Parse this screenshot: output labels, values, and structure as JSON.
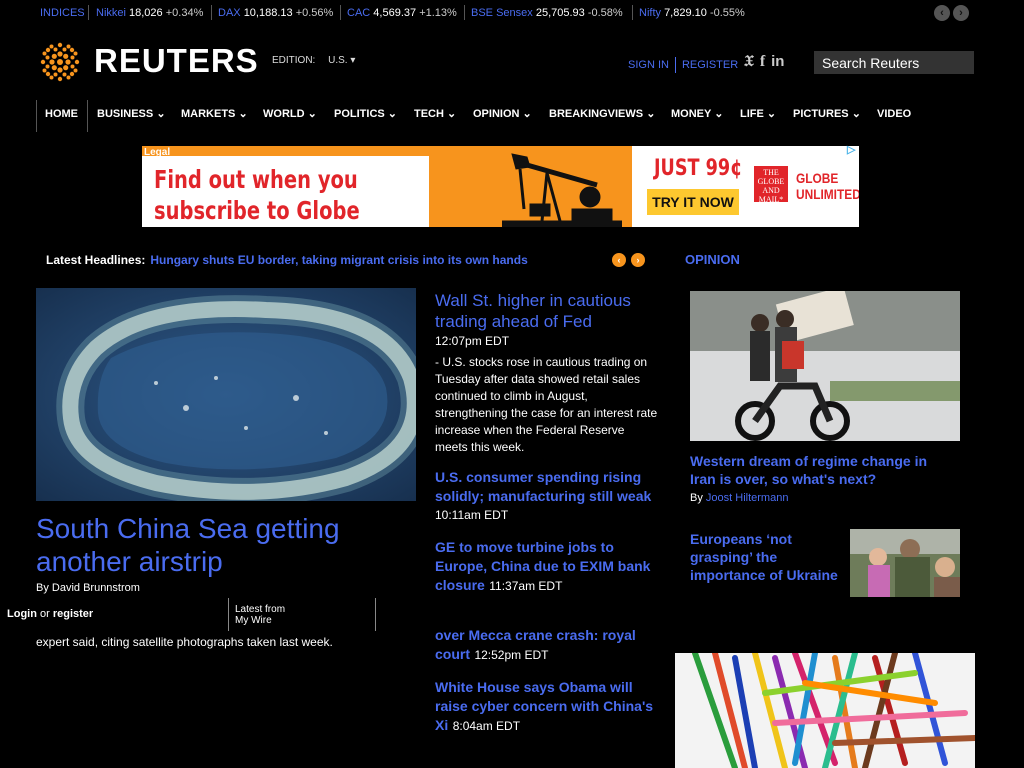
{
  "ticker": {
    "label": "INDICES",
    "items": [
      {
        "name": "Nikkei",
        "value": "18,026",
        "change": "+0.34%"
      },
      {
        "name": "DAX",
        "value": "10,188.13",
        "change": "+0.56%"
      },
      {
        "name": "CAC",
        "value": "4,569.37",
        "change": "+1.13%"
      },
      {
        "name": "BSE Sensex",
        "value": "25,705.93",
        "change": "-0.58%"
      },
      {
        "name": "Nifty",
        "value": "7,829.10",
        "change": "-0.55%"
      }
    ]
  },
  "header": {
    "logo_text": "REUTERS",
    "edition_label": "EDITION:",
    "edition_value": "U.S.",
    "sign_in": "SIGN IN",
    "register": "REGISTER",
    "social": [
      "twitter-icon",
      "facebook-icon",
      "linkedin-icon"
    ],
    "search_placeholder": "Search Reuters"
  },
  "nav": [
    {
      "label": "HOME"
    },
    {
      "label": "BUSINESS"
    },
    {
      "label": "MARKETS"
    },
    {
      "label": "WORLD"
    },
    {
      "label": "POLITICS"
    },
    {
      "label": "TECH"
    },
    {
      "label": "OPINION"
    },
    {
      "label": "BREAKINGVIEWS"
    },
    {
      "label": "MONEY"
    },
    {
      "label": "LIFE"
    },
    {
      "label": "PICTURES"
    },
    {
      "label": "VIDEO"
    }
  ],
  "ad": {
    "tag": "Legal",
    "headline": "Find out when you subscribe to Globe Unlimited.",
    "price": "JUST 99¢",
    "cta": "TRY IT NOW",
    "badge": "THE GLOBE AND MAIL*",
    "brand": "GLOBE UNLIMITED"
  },
  "latest": {
    "label": "Latest Headlines:",
    "headline": "Hungary shuts EU border, taking migrant crisis into its own hands"
  },
  "main_story": {
    "title": "South China Sea getting another airstrip",
    "byline": "By David Brunnstrom",
    "excerpt": "expert said, citing satellite photographs taken last week."
  },
  "login_bar": {
    "login": "Login",
    "or": "or",
    "register": "register",
    "wire": "Latest from My Wire"
  },
  "center_stories": [
    {
      "title": "Wall St. higher in cautious trading ahead of Fed",
      "time": "12:07pm EDT",
      "summary": "- U.S. stocks rose in cautious trading on Tuesday after data showed retail sales continued to climb in August, strengthening the case for an interest rate increase when the Federal Reserve meets this week."
    },
    {
      "title": "U.S. consumer spending rising solidly; manufacturing still weak",
      "time": "10:11am EDT"
    },
    {
      "title": "GE to move turbine jobs to Europe, China due to EXIM bank closure",
      "time": "11:37am EDT"
    },
    {
      "title": "over Mecca crane crash: royal court",
      "time": "12:52pm EDT"
    },
    {
      "title": "White House says Obama will raise cyber concern with China's Xi",
      "time": "8:04am EDT"
    }
  ],
  "opinion": {
    "heading": "OPINION",
    "story1": {
      "title": "Western dream of regime change in Iran is over, so what's next?",
      "by": "By",
      "author": "Joost Hiltermann"
    },
    "story2": {
      "title": "Europeans ‘not grasping’ the importance of Ukraine"
    }
  }
}
